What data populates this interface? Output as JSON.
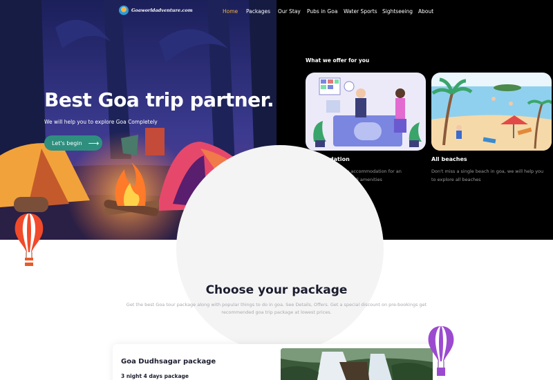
{
  "brand": {
    "name": "Goaworldadventure.com",
    "logo_icon": "globe-logo-icon"
  },
  "nav": {
    "items": [
      {
        "label": "Home",
        "active": true
      },
      {
        "label": "Packages",
        "active": false
      },
      {
        "label": "Our Stay",
        "active": false
      },
      {
        "label": "Pubs in Goa",
        "active": false
      },
      {
        "label": "Water Sports",
        "active": false
      },
      {
        "label": "Sightseeing",
        "active": false
      },
      {
        "label": "About",
        "active": false
      }
    ],
    "active_color": "#f5b53f"
  },
  "hero": {
    "title": "Best Goa trip partner.",
    "subtitle": "We will help you to explore Goa Completely",
    "cta_label": "Let's begin",
    "cta_icon": "arrow-right-icon",
    "cta_color": "#2e8f7f"
  },
  "offers": {
    "heading": "What we offer for you",
    "cards": [
      {
        "title": "Accomadation",
        "description": "We offer you classy accommodation for an affordable price with all amenities"
      },
      {
        "title": "All beaches",
        "description": "Don't miss a single beach in goa, we will help you to explore all beaches"
      }
    ]
  },
  "packages": {
    "heading": "Choose your package",
    "description": "Get the best Goa tour package along with popular things to do in goa. See Details, Offers. Get a special discount on pre-bookings get recommended goa trip package at lowest prices.",
    "items": [
      {
        "name": "Goa Dudhsagar package",
        "duration": "3 night 4 days package"
      }
    ]
  },
  "colors": {
    "dark_bg": "#000000",
    "text_dark": "#1b1d2e"
  }
}
